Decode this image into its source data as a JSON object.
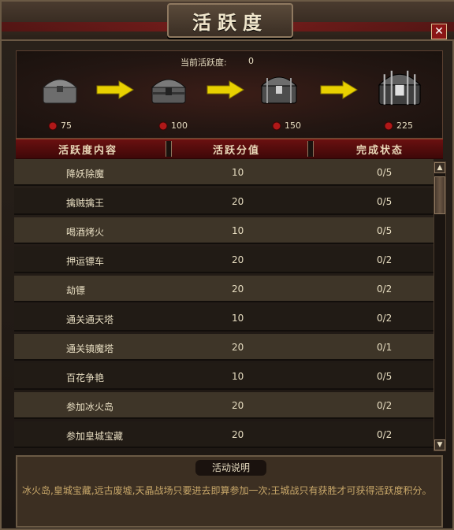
{
  "window": {
    "title": "活跃度",
    "close_label": "✕"
  },
  "activity": {
    "current_label": "当前活跃度:",
    "current_value": "0",
    "rewards": [
      {
        "threshold": "75",
        "icon": "chest-icon"
      },
      {
        "threshold": "100",
        "icon": "chest-icon"
      },
      {
        "threshold": "150",
        "icon": "chest-icon"
      },
      {
        "threshold": "225",
        "icon": "chest-icon"
      }
    ]
  },
  "table": {
    "headers": [
      "活跃度内容",
      "活跃分值",
      "完成状态"
    ],
    "rows": [
      {
        "name": "降妖除魔",
        "score": "10",
        "status": "0/5"
      },
      {
        "name": "擒贼擒王",
        "score": "20",
        "status": "0/5"
      },
      {
        "name": "喝酒烤火",
        "score": "10",
        "status": "0/5"
      },
      {
        "name": "押运镖车",
        "score": "20",
        "status": "0/2"
      },
      {
        "name": "劫镖",
        "score": "20",
        "status": "0/2"
      },
      {
        "name": "通关通天塔",
        "score": "10",
        "status": "0/2"
      },
      {
        "name": "通关镇魔塔",
        "score": "20",
        "status": "0/1"
      },
      {
        "name": "百花争艳",
        "score": "10",
        "status": "0/5"
      },
      {
        "name": "参加冰火岛",
        "score": "20",
        "status": "0/2"
      },
      {
        "name": "参加皇城宝藏",
        "score": "20",
        "status": "0/2"
      }
    ]
  },
  "description": {
    "title": "活动说明",
    "text": "冰火岛,皇城宝藏,远古废墟,天晶战场只要进去即算参加一次;王城战只有获胜才可获得活跃度积分。"
  },
  "colors": {
    "accent": "#8a1515",
    "gold": "#e8d000"
  }
}
